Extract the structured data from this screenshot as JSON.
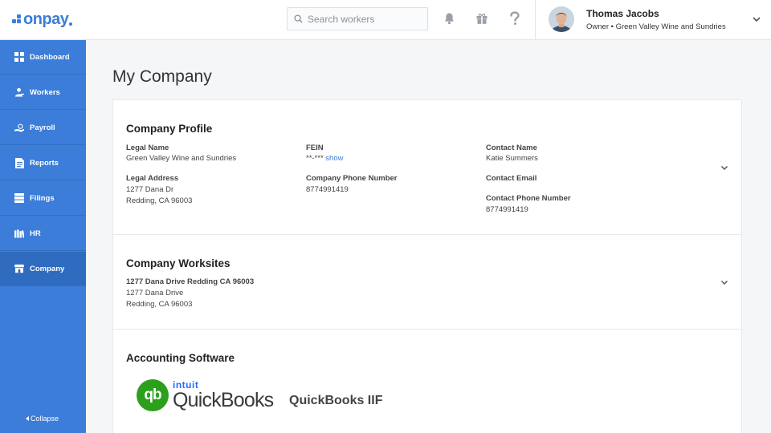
{
  "brand": {
    "logo_text": "onpay",
    "accent": "#3b7dd8"
  },
  "header": {
    "search_placeholder": "Search workers",
    "icons": [
      "bell-icon",
      "gift-icon",
      "help-icon"
    ],
    "user": {
      "name": "Thomas Jacobs",
      "role": "Owner • Green Valley Wine and Sundries"
    }
  },
  "sidebar": {
    "items": [
      {
        "label": "Dashboard",
        "icon": "dashboard-icon"
      },
      {
        "label": "Workers",
        "icon": "workers-icon"
      },
      {
        "label": "Payroll",
        "icon": "payroll-icon"
      },
      {
        "label": "Reports",
        "icon": "reports-icon"
      },
      {
        "label": "Filings",
        "icon": "filings-icon"
      },
      {
        "label": "HR",
        "icon": "hr-icon"
      },
      {
        "label": "Company",
        "icon": "company-icon",
        "active": true
      }
    ],
    "collapse_label": "Collapse"
  },
  "main": {
    "title": "My Company",
    "profile": {
      "title": "Company Profile",
      "legal_name_label": "Legal Name",
      "legal_name": "Green Valley Wine and Sundries",
      "legal_address_label": "Legal Address",
      "legal_address_line1": "1277 Dana Dr",
      "legal_address_line2": "Redding, CA 96003",
      "fein_label": "FEIN",
      "fein_masked": "**-***",
      "fein_show": "show",
      "phone_label": "Company Phone Number",
      "phone": "8774991419",
      "contact_name_label": "Contact Name",
      "contact_name": "Katie Summers",
      "contact_email_label": "Contact Email",
      "contact_phone_label": "Contact Phone Number",
      "contact_phone": "8774991419"
    },
    "worksites": {
      "title": "Company Worksites",
      "site_name": "1277 Dana Drive Redding CA 96003",
      "site_line1": "1277 Dana Drive",
      "site_line2": "Redding, CA 96003"
    },
    "accounting": {
      "title": "Accounting Software",
      "logo_intuit": "intuit",
      "logo_brand": "QuickBooks",
      "logo_mark": "qb",
      "software_name": "QuickBooks IIF"
    }
  }
}
